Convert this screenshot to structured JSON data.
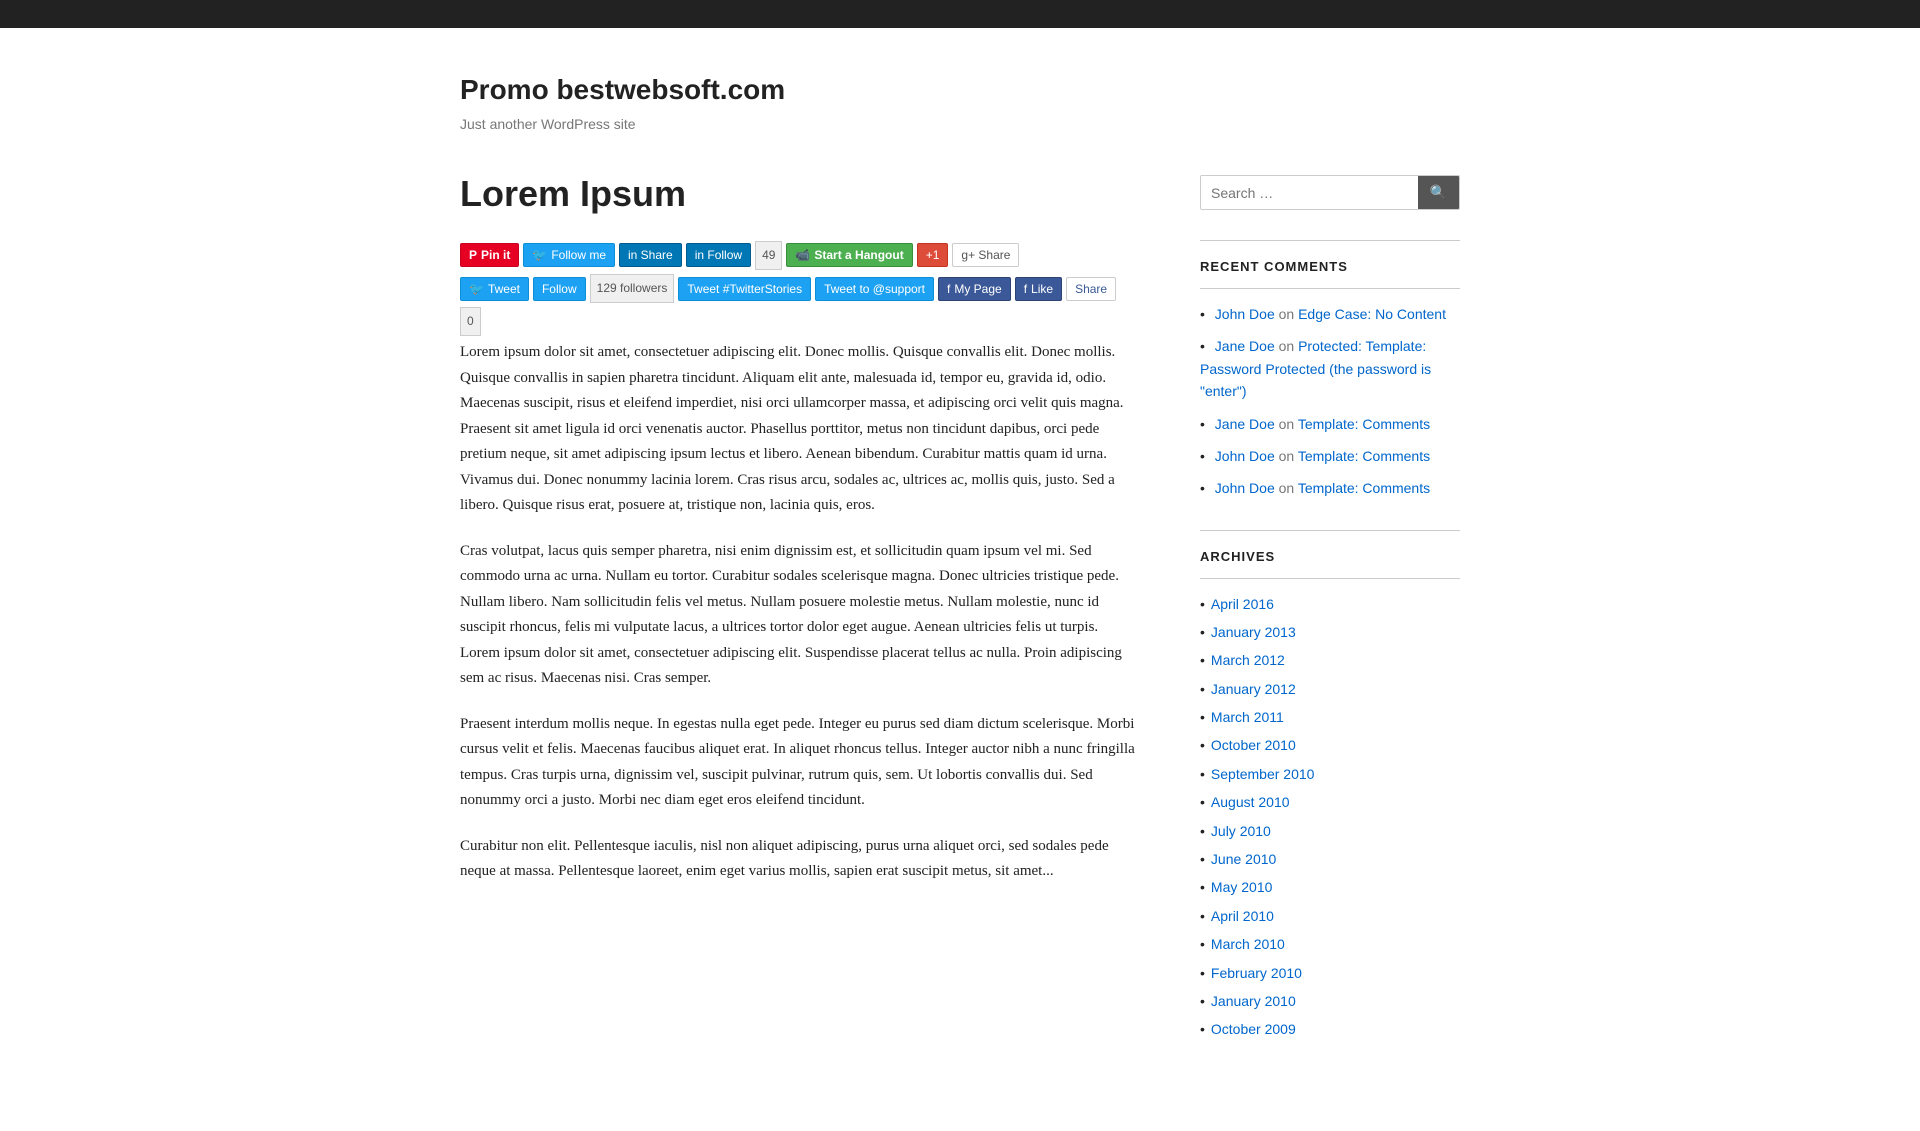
{
  "topBar": {},
  "header": {
    "title": "Promo bestwebsoft.com",
    "tagline": "Just another WordPress site"
  },
  "post": {
    "title": "Lorem Ipsum",
    "paragraphs": [
      "Lorem ipsum dolor sit amet, consectetuer adipiscing elit. Donec mollis. Quisque convallis elit. Donec mollis. Quisque convallis in sapien pharetra tincidunt. Aliquam elit ante, malesuada id, tempor eu, gravida id, odio. Maecenas suscipit, risus et eleifend imperdiet, nisi orci ullamcorper massa, et adipiscing orci velit quis magna. Praesent sit amet ligula id orci venenatis auctor. Phasellus porttitor, metus non tincidunt dapibus, orci pede pretium neque, sit amet adipiscing ipsum lectus et libero. Aenean bibendum. Curabitur mattis quam id urna. Vivamus dui. Donec nonummy lacinia lorem. Cras risus arcu, sodales ac, ultrices ac, mollis quis, justo. Sed a libero. Quisque risus erat, posuere at, tristique non, lacinia quis, eros.",
      "Cras volutpat, lacus quis semper pharetra, nisi enim dignissim est, et sollicitudin quam ipsum vel mi. Sed commodo urna ac urna. Nullam eu tortor. Curabitur sodales scelerisque magna. Donec ultricies tristique pede. Nullam libero. Nam sollicitudin felis vel metus. Nullam posuere molestie metus. Nullam molestie, nunc id suscipit rhoncus, felis mi vulputate lacus, a ultrices tortor dolor eget augue. Aenean ultricies felis ut turpis. Lorem ipsum dolor sit amet, consectetuer adipiscing elit. Suspendisse placerat tellus ac nulla. Proin adipiscing sem ac risus. Maecenas nisi. Cras semper.",
      "Praesent interdum mollis neque. In egestas nulla eget pede. Integer eu purus sed diam dictum scelerisque. Morbi cursus velit et felis. Maecenas faucibus aliquet erat. In aliquet rhoncus tellus. Integer auctor nibh a nunc fringilla tempus. Cras turpis urna, dignissim vel, suscipit pulvinar, rutrum quis, sem. Ut lobortis convallis dui. Sed nonummy orci a justo. Morbi nec diam eget eros eleifend tincidunt.",
      "Curabitur non elit. Pellentesque iaculis, nisl non aliquet adipiscing, purus urna aliquet orci, sed sodales pede neque at massa. Pellentesque laoreet, enim eget varius mollis, sapien erat suscipit metus, sit amet..."
    ],
    "socialButtons": {
      "row1": [
        {
          "id": "pinterest",
          "label": "Pin it",
          "style": "pinterest"
        },
        {
          "id": "follow-me",
          "label": "Follow me",
          "style": "follow-me"
        },
        {
          "id": "linkedin-share",
          "label": "Share",
          "style": "linkedin-share"
        },
        {
          "id": "linkedin-follow",
          "label": "Follow",
          "style": "linkedin-follow"
        },
        {
          "id": "linkedin-count",
          "label": "49",
          "style": "count"
        },
        {
          "id": "hangout",
          "label": "Start a Hangout",
          "style": "hangout"
        },
        {
          "id": "g1",
          "label": "+1",
          "style": "g1"
        },
        {
          "id": "gshare",
          "label": "Share",
          "style": "gshare"
        }
      ],
      "row2": [
        {
          "id": "tweet",
          "label": "Tweet",
          "style": "tweet"
        },
        {
          "id": "twitter-follow",
          "label": "Follow",
          "style": "twitter-follow"
        },
        {
          "id": "twitter-followers",
          "label": "129 followers",
          "style": "count"
        },
        {
          "id": "twitter-hashtag",
          "label": "Tweet #TwitterStories",
          "style": "twitter-hashtag"
        },
        {
          "id": "twitter-support",
          "label": "Tweet to @support",
          "style": "twitter-support"
        },
        {
          "id": "fb-page",
          "label": "My Page",
          "style": "fb-page"
        },
        {
          "id": "fb-like",
          "label": "Like",
          "style": "fb-like"
        },
        {
          "id": "fb-share",
          "label": "Share",
          "style": "fb-share"
        },
        {
          "id": "fb-count",
          "label": "0",
          "style": "count"
        }
      ]
    }
  },
  "sidebar": {
    "search": {
      "placeholder": "Search …",
      "buttonLabel": "🔍"
    },
    "recentComments": {
      "title": "RECENT COMMENTS",
      "items": [
        {
          "author": "John Doe",
          "action": "on",
          "link": "Edge Case: No Content"
        },
        {
          "author": "Jane Doe",
          "action": "on",
          "link": "Protected: Template: Password Protected (the password is \"enter\")"
        },
        {
          "author": "Jane Doe",
          "action": "on",
          "link": "Template: Comments"
        },
        {
          "author": "John Doe",
          "action": "on",
          "link": "Template: Comments"
        },
        {
          "author": "John Doe",
          "action": "on",
          "link": "Template: Comments"
        }
      ]
    },
    "archives": {
      "title": "ARCHIVES",
      "items": [
        "April 2016",
        "January 2013",
        "March 2012",
        "January 2012",
        "March 2011",
        "October 2010",
        "September 2010",
        "August 2010",
        "July 2010",
        "June 2010",
        "May 2010",
        "April 2010",
        "March 2010",
        "February 2010",
        "January 2010",
        "October 2009"
      ]
    }
  }
}
